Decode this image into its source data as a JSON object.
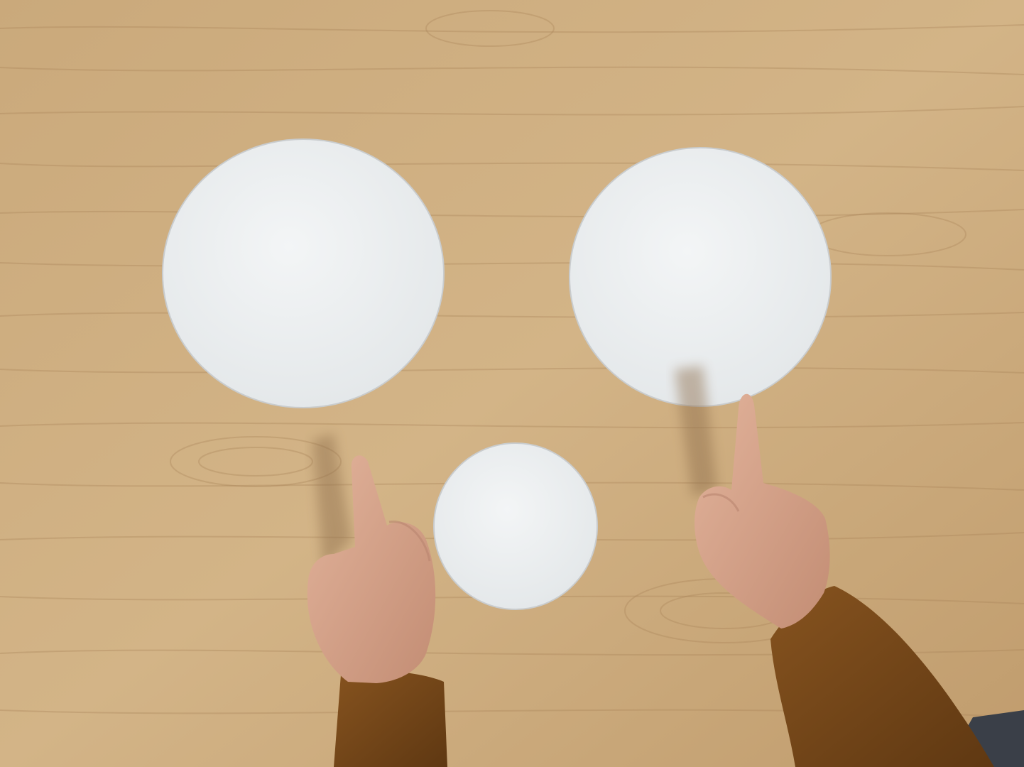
{
  "scene": {
    "description_visible_text": "",
    "colors": {
      "table_wood": "#c9a87a",
      "table_wood_light": "#d8bd92",
      "grain_dark": "#a98458",
      "paper": "#eef1f2",
      "paper_shadow": "#d9dde0",
      "skin": "#d7a58c",
      "skin_shadow": "#b98570",
      "sleeve": "#7a4a1c",
      "sleeve_dark": "#5e3712",
      "cast_shadow": "#8c6c4a",
      "floor_corner": "#3a3f48"
    },
    "objects": [
      {
        "kind": "paper-circle",
        "label": "large-left"
      },
      {
        "kind": "paper-circle",
        "label": "large-right"
      },
      {
        "kind": "paper-circle",
        "label": "small-center"
      },
      {
        "kind": "hand",
        "label": "left-hand-pointing"
      },
      {
        "kind": "hand",
        "label": "right-hand-pointing"
      }
    ]
  }
}
